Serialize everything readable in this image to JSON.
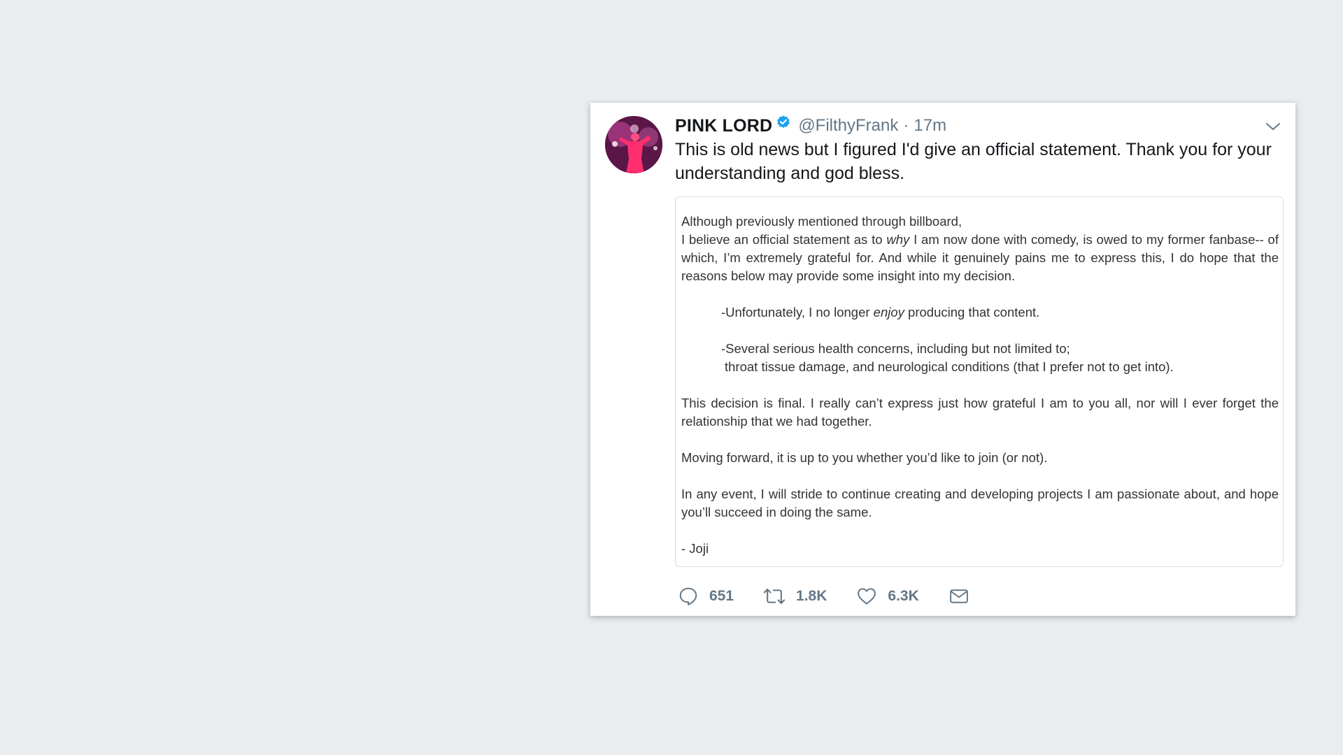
{
  "tweet": {
    "display_name": "PINK LORD",
    "handle": "@FilthyFrank",
    "separator": "·",
    "time": "17m",
    "text": "This is old news but I figured I'd give an official statement. Thank you for your understanding and god bless."
  },
  "statement": {
    "intro_line1": "Although previously mentioned through billboard,",
    "intro_line2_a": "I believe an official statement as to ",
    "intro_line2_em": "why",
    "intro_line2_b": " I am now done with comedy, is owed to my former fanbase-- of which, I’m extremely grateful for. And while it genuinely pains me to express this, I do hope that the reasons below may provide some insight into my decision.",
    "reason1_a": "-Unfortunately, I no longer ",
    "reason1_em": "enjoy",
    "reason1_b": " producing that content.",
    "reason2_line1": "-Several serious health concerns, including but not limited to;",
    "reason2_line2": "throat tissue damage, and neurological conditions (that I prefer not to get into).",
    "para_final": "This decision is final. I really can’t express just how grateful I am to you all, nor will I ever forget the relationship that we had together.",
    "para_forward": "Moving forward, it is up to you whether you’d like to join (or not).",
    "para_event": "In any event, I will stride to continue creating and developing projects I am passionate about, and hope you’ll succeed in doing the same.",
    "signature": "- Joji"
  },
  "actions": {
    "reply_count": "651",
    "retweet_count": "1.8K",
    "like_count": "6.3K"
  },
  "icons": {
    "verified": "verified-badge-icon",
    "menu": "chevron-down-icon",
    "reply": "reply-icon",
    "retweet": "retweet-icon",
    "like": "heart-icon",
    "message": "envelope-icon"
  },
  "colors": {
    "background": "#e9edf0",
    "verified_blue": "#1da1f2",
    "secondary_text": "#657786",
    "primary_text": "#14171a"
  }
}
